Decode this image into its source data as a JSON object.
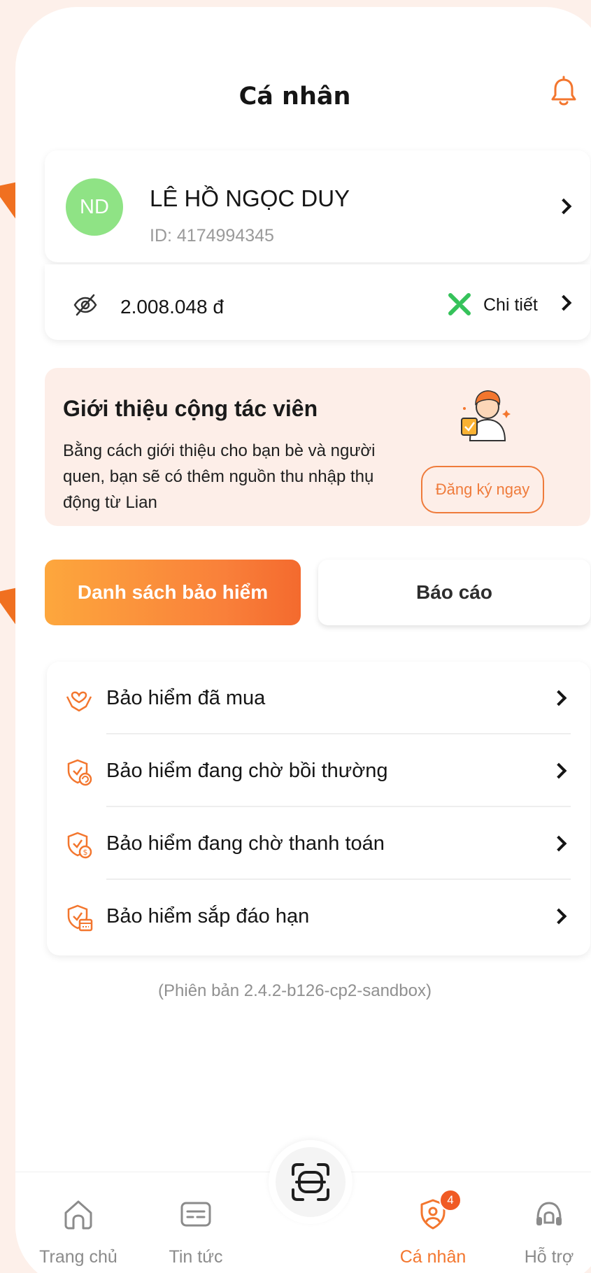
{
  "header": {
    "title": "Cá nhân",
    "bell_icon": "bell-icon"
  },
  "profile": {
    "initials": "ND",
    "name": "LÊ HỒ NGỌC DUY",
    "id_text": "ID: 4174994345",
    "avatar_color": "#8fe385"
  },
  "balance": {
    "amount": "2.008.048 đ",
    "detail_label": "Chi tiết"
  },
  "promo": {
    "title": "Giới thiệu cộng tác viên",
    "description": "Bằng cách giới thiệu cho bạn bè và người quen, bạn sẽ có thêm nguồn thu nhập thụ động từ Lian",
    "button_label": "Đăng ký ngay"
  },
  "tabs": [
    {
      "label": "Danh sách bảo hiểm",
      "active": true
    },
    {
      "label": "Báo cáo",
      "active": false
    }
  ],
  "menu": [
    {
      "label": "Bảo hiểm đã mua",
      "icon": "heart-hands-icon"
    },
    {
      "label": "Bảo hiểm đang chờ bồi thường",
      "icon": "shield-refresh-icon"
    },
    {
      "label": "Bảo hiểm đang chờ thanh toán",
      "icon": "shield-coin-icon"
    },
    {
      "label": "Bảo hiểm sắp đáo hạn",
      "icon": "shield-calendar-icon"
    }
  ],
  "version": "(Phiên bản 2.4.2-b126-cp2-sandbox)",
  "bottom_nav": [
    {
      "label": "Trang chủ",
      "icon": "home-icon"
    },
    {
      "label": "Tin tức",
      "icon": "news-icon"
    },
    {
      "label": "Cá nhân",
      "icon": "profile-icon",
      "active": true,
      "badge": "4"
    },
    {
      "label": "Hỗ trợ",
      "icon": "support-icon"
    }
  ],
  "colors": {
    "accent": "#f3762e",
    "background": "#fdf0ea",
    "promo_background": "#fdeee8"
  }
}
